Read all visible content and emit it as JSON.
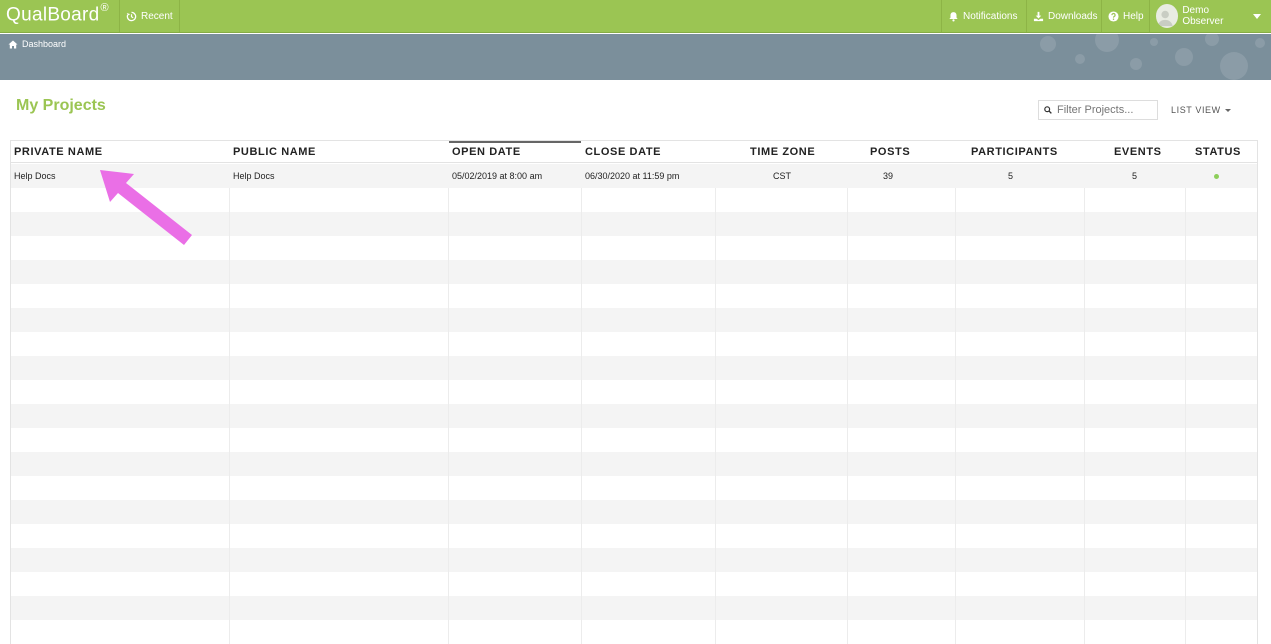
{
  "app": {
    "name": "QualBoard",
    "mark": "®"
  },
  "nav": {
    "recent_label": "Recent",
    "notifications_label": "Notifications",
    "downloads_label": "Downloads",
    "help_label": "Help",
    "user_label": "Demo Observer"
  },
  "breadcrumb": {
    "label": "Dashboard"
  },
  "page": {
    "title": "My Projects"
  },
  "filter": {
    "placeholder": "Filter Projects..."
  },
  "view": {
    "label": "LIST VIEW"
  },
  "table": {
    "columns": [
      "PRIVATE NAME",
      "PUBLIC NAME",
      "OPEN DATE",
      "CLOSE DATE",
      "TIME ZONE",
      "POSTS",
      "PARTICIPANTS",
      "EVENTS",
      "STATUS"
    ],
    "sorted_column": "OPEN DATE",
    "rows": [
      {
        "private_name": "Help Docs",
        "public_name": "Help Docs",
        "open_date": "05/02/2019 at 8:00 am",
        "close_date": "06/30/2020 at 11:59 pm",
        "time_zone": "CST",
        "posts": "39",
        "participants": "5",
        "events": "5",
        "status": "active"
      }
    ]
  },
  "colors": {
    "brand_green": "#9bc553",
    "banner": "#7b8f9b",
    "status_active": "#8dce5a",
    "annotation_arrow": "#ea6fe6"
  },
  "icons": {
    "recent": "history-icon",
    "notifications": "bell-icon",
    "downloads": "download-icon",
    "help": "question-circle-icon",
    "breadcrumb": "home-icon",
    "filter": "search-icon"
  }
}
